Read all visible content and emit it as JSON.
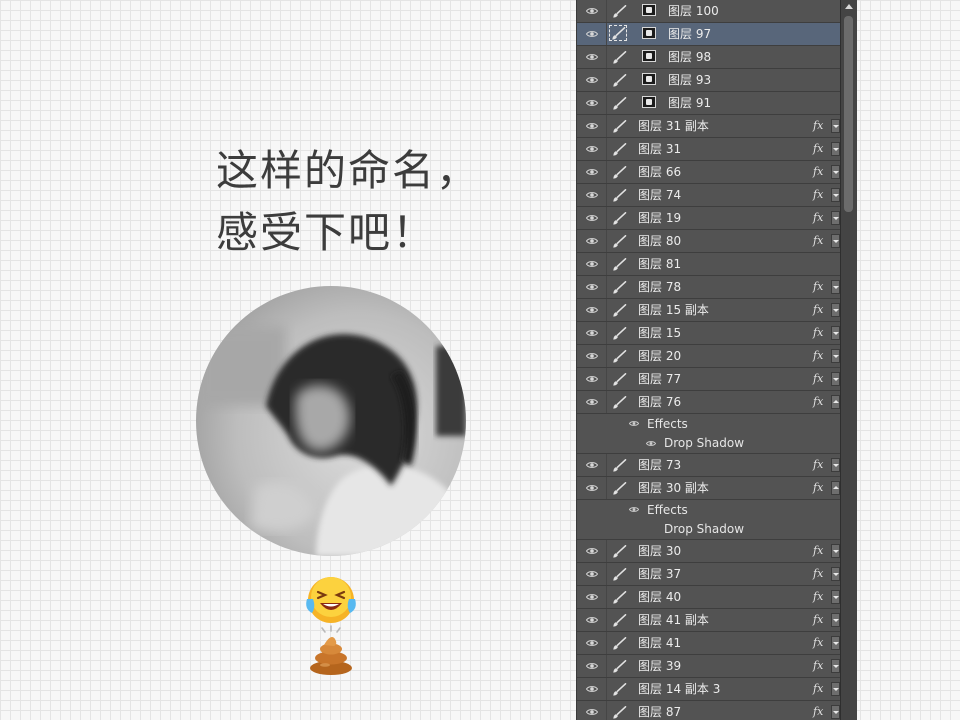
{
  "canvas": {
    "caption_lines": [
      "这样的命名，",
      "感受下吧！"
    ],
    "images": [
      {
        "name": "avatar-photo",
        "desc": "circular grayscale photo"
      },
      {
        "name": "laughing-crying-emoji"
      },
      {
        "name": "poop-emoji"
      }
    ]
  },
  "layers_panel": {
    "rows": [
      {
        "type": "layer",
        "name": "图层 100",
        "mask": true,
        "fx": false,
        "selected": false
      },
      {
        "type": "layer",
        "name": "图层 97",
        "mask": true,
        "fx": false,
        "selected": true
      },
      {
        "type": "layer",
        "name": "图层 98",
        "mask": true,
        "fx": false,
        "selected": false
      },
      {
        "type": "layer",
        "name": "图层 93",
        "mask": true,
        "fx": false,
        "selected": false
      },
      {
        "type": "layer",
        "name": "图层 91",
        "mask": true,
        "fx": false,
        "selected": false
      },
      {
        "type": "layer",
        "name": "图层 31 副本",
        "mask": false,
        "fx": true,
        "expanded": false
      },
      {
        "type": "layer",
        "name": "图层 31",
        "mask": false,
        "fx": true,
        "expanded": false
      },
      {
        "type": "layer",
        "name": "图层 66",
        "mask": false,
        "fx": true,
        "expanded": false
      },
      {
        "type": "layer",
        "name": "图层 74",
        "mask": false,
        "fx": true,
        "expanded": false
      },
      {
        "type": "layer",
        "name": "图层 19",
        "mask": false,
        "fx": true,
        "expanded": false
      },
      {
        "type": "layer",
        "name": "图层 80",
        "mask": false,
        "fx": true,
        "expanded": false
      },
      {
        "type": "layer",
        "name": "图层 81",
        "mask": false,
        "fx": false
      },
      {
        "type": "layer",
        "name": "图层 78",
        "mask": false,
        "fx": true,
        "expanded": false
      },
      {
        "type": "layer",
        "name": "图层 15 副本",
        "mask": false,
        "fx": true,
        "expanded": false
      },
      {
        "type": "layer",
        "name": "图层 15",
        "mask": false,
        "fx": true,
        "expanded": false
      },
      {
        "type": "layer",
        "name": "图层 20",
        "mask": false,
        "fx": true,
        "expanded": false
      },
      {
        "type": "layer",
        "name": "图层 77",
        "mask": false,
        "fx": true,
        "expanded": false
      },
      {
        "type": "layer",
        "name": "图层 76",
        "mask": false,
        "fx": true,
        "expanded": true
      },
      {
        "type": "effects",
        "label": "Effects"
      },
      {
        "type": "effect",
        "label": "Drop Shadow",
        "eye": true
      },
      {
        "type": "layer",
        "name": "图层 73",
        "mask": false,
        "fx": true,
        "expanded": false
      },
      {
        "type": "layer",
        "name": "图层 30 副本",
        "mask": false,
        "fx": true,
        "expanded": true
      },
      {
        "type": "effects",
        "label": "Effects"
      },
      {
        "type": "effect",
        "label": "Drop Shadow",
        "eye": false
      },
      {
        "type": "layer",
        "name": "图层 30",
        "mask": false,
        "fx": true,
        "expanded": false
      },
      {
        "type": "layer",
        "name": "图层 37",
        "mask": false,
        "fx": true,
        "expanded": false
      },
      {
        "type": "layer",
        "name": "图层 40",
        "mask": false,
        "fx": true,
        "expanded": false
      },
      {
        "type": "layer",
        "name": "图层 41 副本",
        "mask": false,
        "fx": true,
        "expanded": false
      },
      {
        "type": "layer",
        "name": "图层 41",
        "mask": false,
        "fx": true,
        "expanded": false
      },
      {
        "type": "layer",
        "name": "图层 39",
        "mask": false,
        "fx": true,
        "expanded": false
      },
      {
        "type": "layer",
        "name": "图层 14 副本 3",
        "mask": false,
        "fx": true,
        "expanded": false
      },
      {
        "type": "layer",
        "name": "图层 87",
        "mask": false,
        "fx": true,
        "expanded": false
      }
    ],
    "fx_label": "fx"
  },
  "colors": {
    "panel_bg": "#535353",
    "selected_row": "#58667a",
    "caption_text": "#3c3c3c",
    "canvas_bg": "#f7f7f7"
  },
  "icons": [
    "visibility-eye-icon",
    "paint-brush-icon",
    "layer-mask-icon",
    "fx-icon",
    "fx-toggle-arrow-icon"
  ]
}
